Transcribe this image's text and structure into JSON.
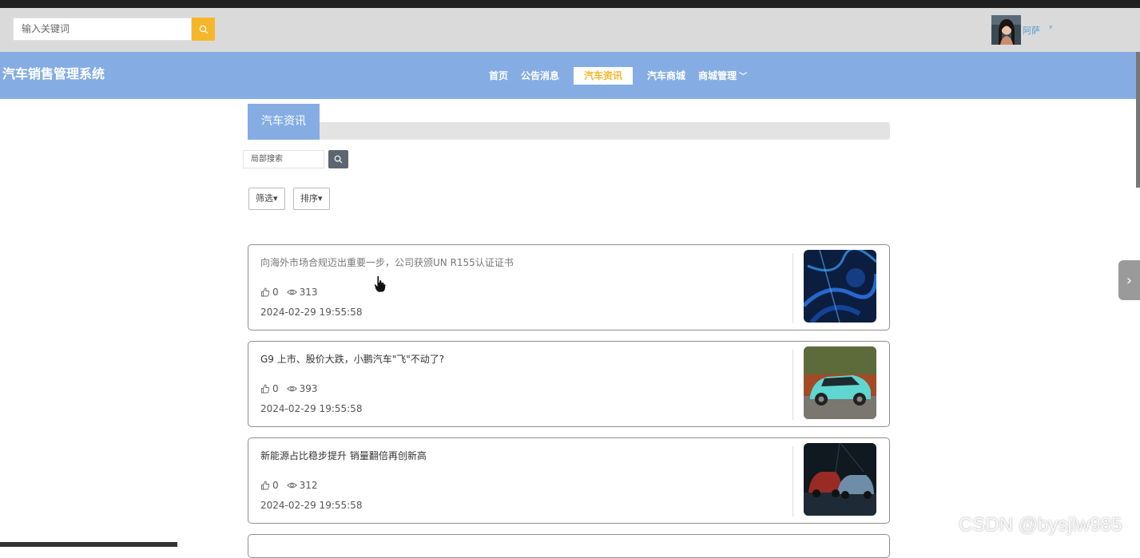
{
  "topbar": {
    "search_placeholder": "输入关键词",
    "username": "阿萨"
  },
  "navbar": {
    "site_title": "汽车销售管理系统",
    "items": [
      {
        "label": "首页"
      },
      {
        "label": "公告消息"
      },
      {
        "label": "汽车资讯",
        "active": true
      },
      {
        "label": "汽车商城"
      },
      {
        "label": "商城管理"
      }
    ]
  },
  "section": {
    "tab_label": "汽车资讯",
    "local_search_placeholder": "局部搜索",
    "filter_label": "筛选▾",
    "sort_label": "排序▾"
  },
  "articles": [
    {
      "title": "向海外市场合规迈出重要一步，公司获颁UN R155认证证书",
      "likes": "0",
      "views": "313",
      "date": "2024-02-29 19:55:58"
    },
    {
      "title": "G9 上市、股价大跌，小鹏汽车\"飞\"不动了?",
      "likes": "0",
      "views": "393",
      "date": "2024-02-29 19:55:58"
    },
    {
      "title": "新能源占比稳步提升 销量翻倍再创新高",
      "likes": "0",
      "views": "312",
      "date": "2024-02-29 19:55:58"
    }
  ],
  "watermark": "CSDN @bysjlw985",
  "colors": {
    "navbar": "#85ade3",
    "accent": "#f5b62a",
    "topbar": "#dadada"
  }
}
